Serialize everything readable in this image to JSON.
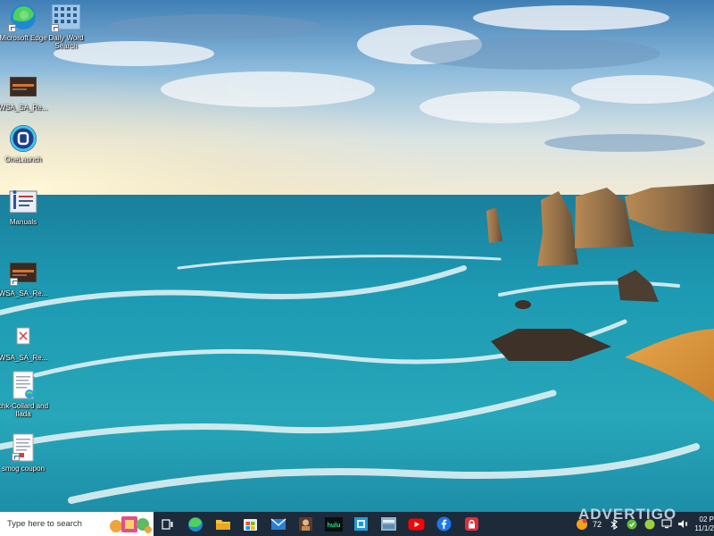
{
  "desktop": {
    "icons": [
      {
        "label": "Microsoft Edge",
        "icon": "edge-icon"
      },
      {
        "label": "Daily Word Search",
        "icon": "word-search-icon"
      },
      {
        "label": "WSA_SA_Re...",
        "icon": "wsa-file-icon"
      },
      {
        "label": "OneLaunch",
        "icon": "onelaunch-icon"
      },
      {
        "label": "Manuals",
        "icon": "manuals-icon"
      },
      {
        "label": "WSA_SA_Re...",
        "icon": "wsa-file-icon"
      },
      {
        "label": "WSA_SA_Re...",
        "icon": "pdf-file-icon"
      },
      {
        "label": "chk-Coilard and Ilada",
        "icon": "document-icon"
      },
      {
        "label": "smog coupon",
        "icon": "document-icon"
      }
    ]
  },
  "taskbar": {
    "search_placeholder": "Type here to search",
    "apps": [
      "task-view-icon",
      "edge-icon",
      "file-explorer-icon",
      "store-icon",
      "mail-icon",
      "photo-app-icon",
      "hulu-icon",
      "app-icon",
      "game-icon",
      "youtube-icon",
      "facebook-icon",
      "lock-app-icon"
    ],
    "hulu_text": "hulu",
    "temperature": "72",
    "clock_time": "02 P",
    "clock_date": "11/1/2"
  },
  "watermark": "ADVERTIGO",
  "colors": {
    "taskbar": "#1c2a3a",
    "sea": "#1a8fa8",
    "sky": "#7fb3d8"
  }
}
